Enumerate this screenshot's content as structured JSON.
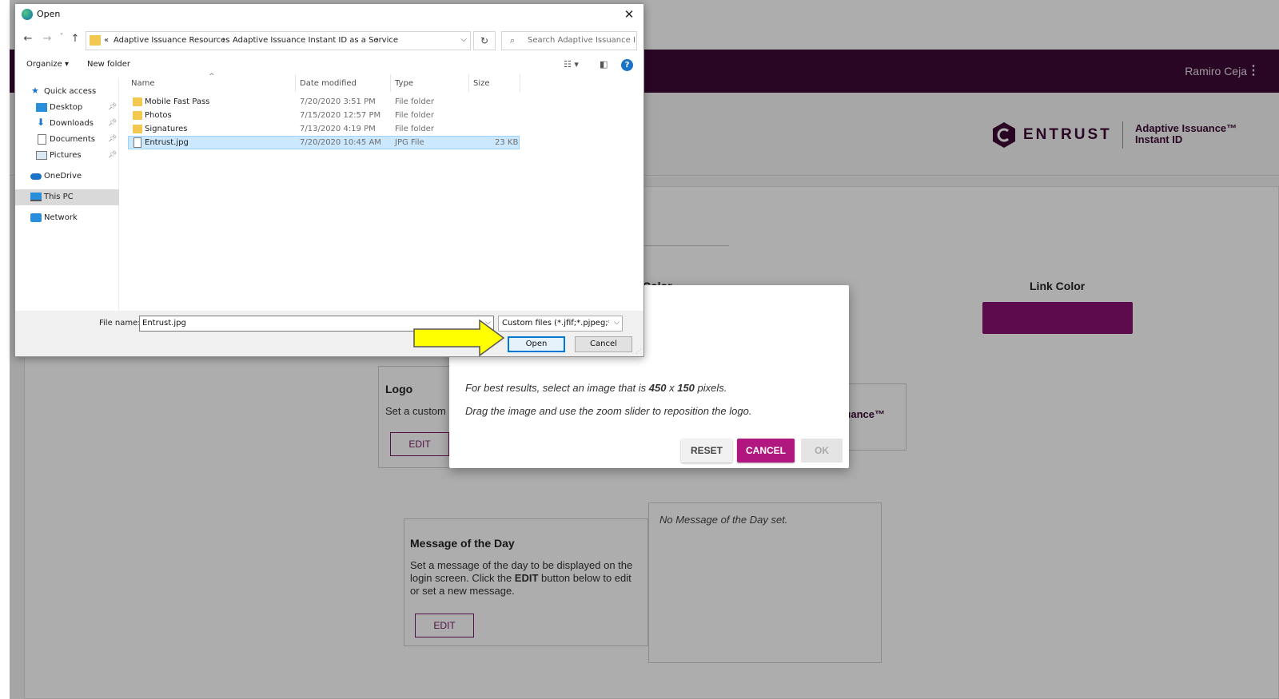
{
  "app": {
    "user_name": "Ramiro Ceja",
    "menu_glyph": "⋮",
    "brand": {
      "company": "ENTRUST",
      "product_line1": "Adaptive Issuance™",
      "product_line2": "Instant ID",
      "color": "#3c0a36"
    },
    "colors": {
      "topbar": "#3c0a36",
      "link_color_swatch": "#8a0f70",
      "accent": "#b0177f"
    },
    "link_color_title": "Link Color",
    "secondary_color_title_partial": "Color",
    "logo_card": {
      "title": "Logo",
      "text_partial": "Set a custom",
      "edit_label": "EDIT",
      "preview_text_partial": "uance™"
    },
    "motd_card": {
      "title": "Message of the Day",
      "text_before_bold": "Set a message of the day to be displayed on the login screen. Click the ",
      "text_bold": "EDIT",
      "text_after_bold": " button below to edit or set a new message.",
      "edit_label": "EDIT",
      "preview_text": "No Message of the Day set."
    }
  },
  "modal": {
    "line1_prefix": "For best results, select an image that is ",
    "line1_width": "450",
    "line1_x": " x ",
    "line1_height": "150",
    "line1_suffix": " pixels.",
    "line2": "Drag the image and use the zoom slider to reposition the logo.",
    "reset_label": "RESET",
    "cancel_label": "CANCEL",
    "ok_label": "OK"
  },
  "file_dialog": {
    "title": "Open",
    "close_glyph": "✕",
    "nav": {
      "back": "←",
      "forward": "→",
      "recent": "˅",
      "up": "↑"
    },
    "breadcrumb": [
      "«",
      "Adaptive Issuance Resources",
      "›",
      "Adaptive Issuance Instant ID as a Service",
      "›"
    ],
    "refresh_glyph": "↻",
    "search_placeholder": "Search Adaptive Issuance Ins...",
    "toolbar": {
      "organize": "Organize ▾",
      "new_folder": "New folder",
      "help": "?"
    },
    "nav_pane": [
      {
        "label": "Quick access",
        "icon": "star-icon",
        "pinned": false
      },
      {
        "label": "Desktop",
        "icon": "desktop-icon",
        "pinned": true
      },
      {
        "label": "Downloads",
        "icon": "download-icon",
        "pinned": true
      },
      {
        "label": "Documents",
        "icon": "document-icon",
        "pinned": true
      },
      {
        "label": "Pictures",
        "icon": "pictures-icon",
        "pinned": true
      },
      {
        "label": "OneDrive",
        "icon": "cloud-icon",
        "pinned": false
      },
      {
        "label": "This PC",
        "icon": "pc-icon",
        "pinned": false,
        "selected": true
      },
      {
        "label": "Network",
        "icon": "network-icon",
        "pinned": false
      }
    ],
    "columns": [
      "Name",
      "Date modified",
      "Type",
      "Size"
    ],
    "files": [
      {
        "name": "Mobile Fast Pass",
        "date": "7/20/2020 3:51 PM",
        "type": "File folder",
        "size": "",
        "kind": "folder"
      },
      {
        "name": "Photos",
        "date": "7/15/2020 12:57 PM",
        "type": "File folder",
        "size": "",
        "kind": "folder"
      },
      {
        "name": "Signatures",
        "date": "7/13/2020 4:19 PM",
        "type": "File folder",
        "size": "",
        "kind": "folder"
      },
      {
        "name": "Entrust.jpg",
        "date": "7/20/2020 10:45 AM",
        "type": "JPG File",
        "size": "23 KB",
        "kind": "image",
        "selected": true
      }
    ],
    "file_name_label": "File name:",
    "file_name_value": "Entrust.jpg",
    "file_type_filter": "Custom files (*.jfif;*.pjpeg;*.jpe",
    "open_label": "Open",
    "cancel_label": "Cancel"
  },
  "callout": {
    "color": "#ffff00",
    "shape": "arrow-right"
  }
}
